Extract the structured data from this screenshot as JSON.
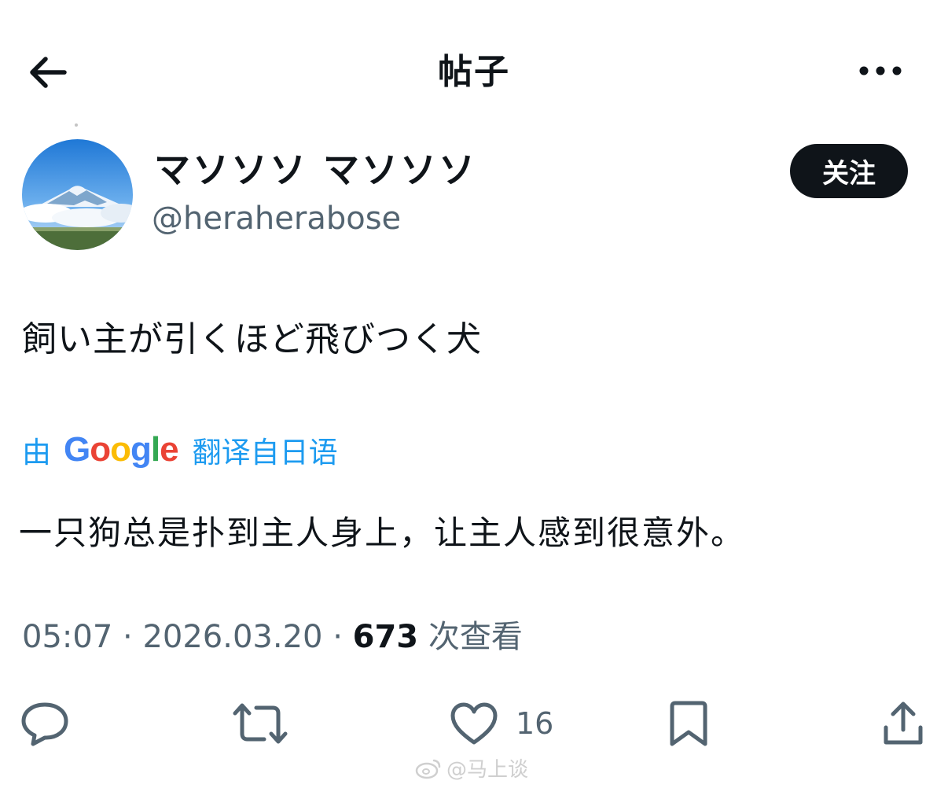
{
  "header": {
    "title": "帖子",
    "back_icon": "arrow-left-icon",
    "more_icon": "more-horizontal-icon"
  },
  "author": {
    "display_name": "マソソソ マソソソ",
    "handle": "@heraherabose",
    "follow_label": "关注"
  },
  "post": {
    "text": "飼い主が引くほど飛びつく犬",
    "translation": {
      "prefix": "由",
      "brand": "Google",
      "suffix": "翻译自日语",
      "text": "一只狗总是扑到主人身上，让主人感到很意外。"
    },
    "time": "05:07",
    "date": "2026.03.20",
    "separator": "·",
    "views_count": "673",
    "views_label": "次查看"
  },
  "actions": {
    "reply_icon": "reply-icon",
    "repost_icon": "repost-icon",
    "like_icon": "heart-icon",
    "like_count": "16",
    "bookmark_icon": "bookmark-icon",
    "share_icon": "share-icon"
  },
  "watermark": {
    "text": "@马上谈"
  },
  "colors": {
    "text": "#0f1419",
    "secondary": "#536471",
    "link": "#1d9bf0",
    "button_bg": "#0f1419"
  }
}
